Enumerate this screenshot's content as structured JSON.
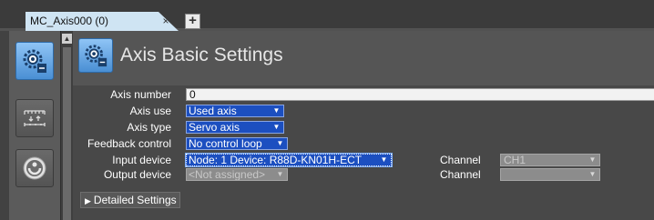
{
  "tab": {
    "label": "MC_Axis000 (0)",
    "close_glyph": "×",
    "new_tab_glyph": "+"
  },
  "sidebar": {
    "buttons": [
      {
        "icon": "axis-settings-icon",
        "active": true
      },
      {
        "icon": "unit-conversion-icon",
        "active": false
      },
      {
        "icon": "operation-settings-icon",
        "active": false
      }
    ]
  },
  "header": {
    "title": "Axis Basic Settings",
    "icon": "axis-settings-icon"
  },
  "form": {
    "axis_number": {
      "label": "Axis number",
      "value": "0"
    },
    "axis_use": {
      "label": "Axis use",
      "value": "Used axis"
    },
    "axis_type": {
      "label": "Axis type",
      "value": "Servo axis"
    },
    "feedback_control": {
      "label": "Feedback control",
      "value": "No control loop"
    },
    "input_device": {
      "label": "Input device",
      "value": "Node: 1  Device: R88D-KN01H-ECT"
    },
    "output_device": {
      "label": "Output device",
      "value": "<Not assigned>"
    },
    "input_channel": {
      "label": "Channel",
      "value": "CH1"
    },
    "output_channel": {
      "label": "Channel",
      "value": ""
    },
    "dropdown_arrow": "▼"
  },
  "detailed_settings": {
    "label": "Detailed Settings",
    "glyph": "▶"
  },
  "colors": {
    "dropdown_active": "#1c4fc0",
    "button_active": "#5a9ee0",
    "panel_bg": "#555555",
    "tab_bg": "#cfe4f3"
  }
}
